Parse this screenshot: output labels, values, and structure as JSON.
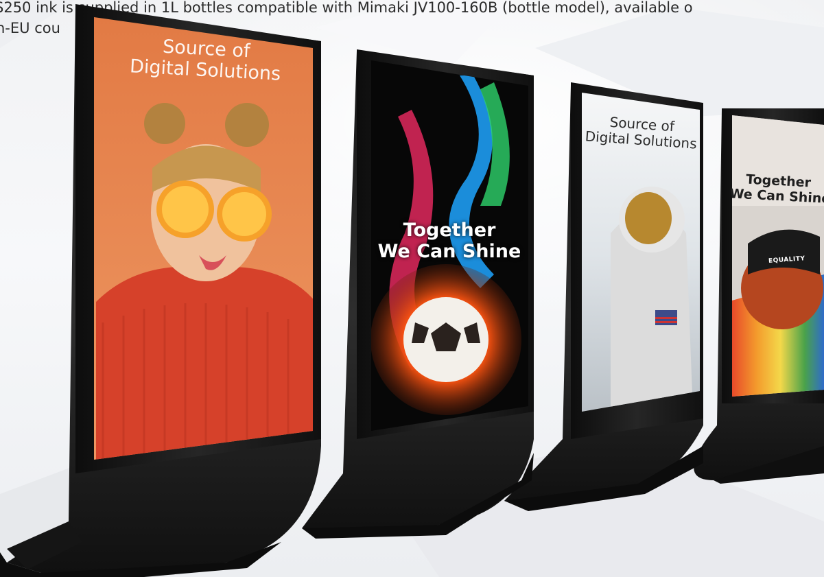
{
  "caption": {
    "line1": "S250 ink is supplied in 1L bottles compatible with Mimaki JV100-160B (bottle model), available o",
    "line2": "n-EU cou"
  },
  "screens": [
    {
      "line1": "Source of",
      "line2": "Digital Solutions"
    },
    {
      "line1": "Together",
      "line2": "We Can Shine"
    },
    {
      "line1": "Source of",
      "line2": "Digital Solutions"
    },
    {
      "line1": "Together",
      "line2": "We Can Shine"
    }
  ],
  "cap_badge": "EQUALITY",
  "colors": {
    "frame": "#161616",
    "orange_backdrop": "#e9844e",
    "sweater": "#d8432b",
    "flame_red": "#ff4a12",
    "flame_blue": "#19a6ff",
    "sky": "#d7dde2"
  }
}
